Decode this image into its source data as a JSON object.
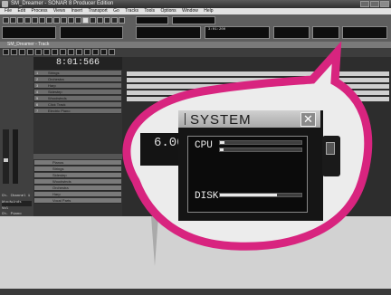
{
  "window": {
    "title": "SM_Dreamer - SONAR 8 Producer Edition"
  },
  "menubar": {
    "items": [
      "File",
      "Edit",
      "Process",
      "Views",
      "Insert",
      "Transport",
      "Go",
      "Tracks",
      "Tools",
      "Options",
      "Window",
      "Help"
    ]
  },
  "toolbar": {
    "transport_time": "8:01:566",
    "tempo": "3:01:200",
    "cpu_label": "CPU",
    "disk_label": "DISK"
  },
  "track_window": {
    "title": "SM_Dreamer - Track",
    "now_time": "8:01:566",
    "tracks": [
      {
        "num": "1",
        "name": "Strings"
      },
      {
        "num": "2",
        "name": "Orchestra"
      },
      {
        "num": "3",
        "name": "Harp"
      },
      {
        "num": "4",
        "name": "Sidestep"
      },
      {
        "num": "5",
        "name": "Woodwinds"
      },
      {
        "num": "6",
        "name": "Click Track"
      },
      {
        "num": "7",
        "name": "Electric Piano"
      }
    ],
    "buses": [
      {
        "name": "Pianos"
      },
      {
        "name": "Strings"
      },
      {
        "name": "Sidestep"
      },
      {
        "name": "Woodwinds"
      },
      {
        "name": "Orchestra"
      },
      {
        "name": "Harp"
      },
      {
        "name": "Vocal Parts"
      }
    ],
    "inspector": {
      "channel": "Ch. Channel 1",
      "preset": "Woodwinds",
      "volume_label": "Vol",
      "bus_label": "Ch. Piano"
    }
  },
  "system_panel": {
    "title": "SYSTEM",
    "close": "✕",
    "cpu_label": "CPU",
    "disk_label": "DISK",
    "cpu_levels": [
      0.05,
      0.04
    ],
    "disk_level": 0.7,
    "left_readout": "6.00"
  },
  "colors": {
    "callout_magenta": "#d8247f",
    "panel_bg": "#151515",
    "header_gray": "#b8b8b8"
  }
}
